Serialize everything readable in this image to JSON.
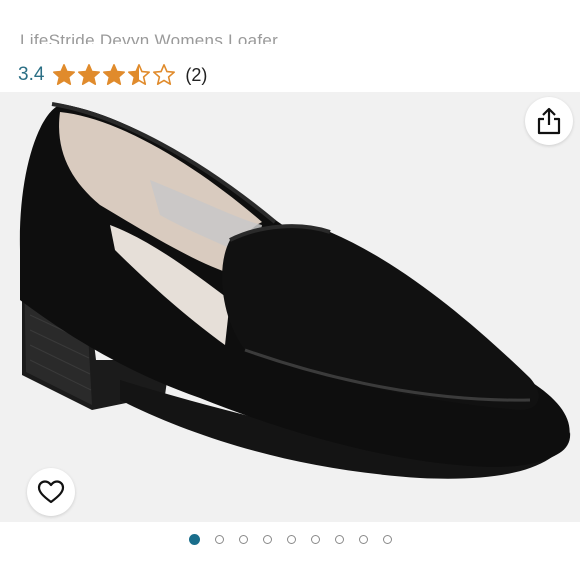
{
  "product": {
    "title": "LifeStride Devyn Womens Loafer",
    "rating_value": "3.4",
    "rating_stars": 3.4,
    "rating_max": 5,
    "review_count": "(2)"
  },
  "colors": {
    "star": "#e08b2c",
    "rating_text": "#2b6f85",
    "active_dot": "#1a6e8c"
  },
  "gallery": {
    "image": "black-suede-heeled-loafer",
    "total_images": 9,
    "active_index": 0
  },
  "icons": {
    "share": "share-icon",
    "favorite": "heart-icon"
  }
}
